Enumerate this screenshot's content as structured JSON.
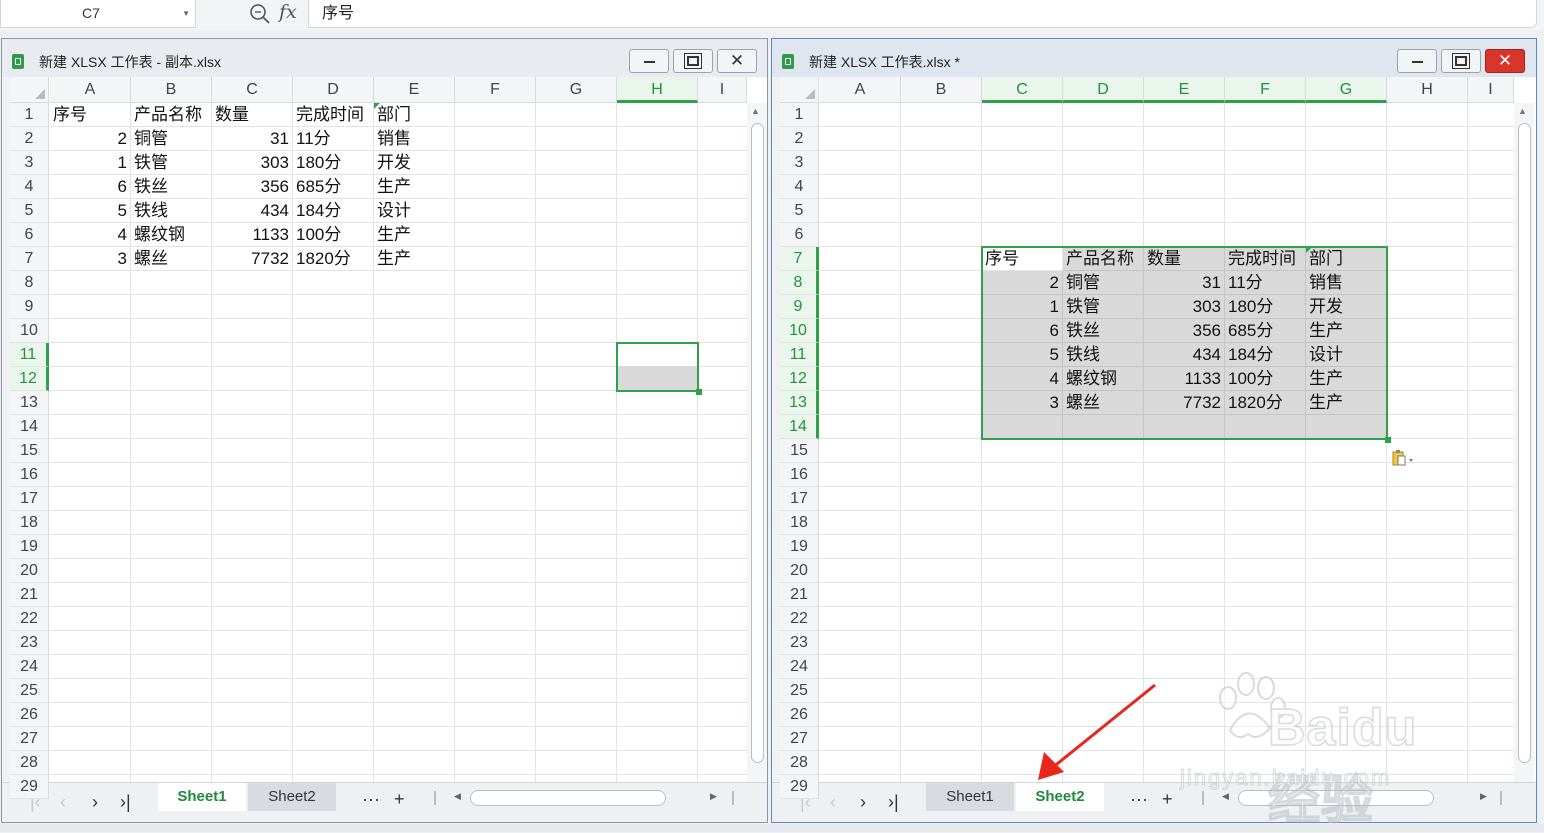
{
  "formula_bar": {
    "name_box": "C7",
    "fx_label": "fx",
    "formula": "序号"
  },
  "columns_all": [
    "A",
    "B",
    "C",
    "D",
    "E",
    "F",
    "G",
    "H",
    "I"
  ],
  "left_window": {
    "title": "新建 XLSX 工作表 - 副本.xlsx",
    "selected_column": "H",
    "selected_rows": [
      11,
      12
    ],
    "rows": [
      "1",
      "2",
      "3",
      "4",
      "5",
      "6",
      "7",
      "8",
      "9",
      "10",
      "11",
      "12",
      "13",
      "14",
      "15",
      "16",
      "17",
      "18",
      "19",
      "20",
      "21",
      "22",
      "23",
      "24",
      "25",
      "26",
      "27",
      "28",
      "29"
    ],
    "tabs": [
      "Sheet1",
      "Sheet2"
    ],
    "active_tab": "Sheet1"
  },
  "right_window": {
    "title": "新建 XLSX 工作表.xlsx *",
    "selected_columns": [
      "C",
      "D",
      "E",
      "F",
      "G"
    ],
    "selected_rows": [
      7,
      8,
      9,
      10,
      11,
      12,
      13,
      14
    ],
    "rows": [
      "1",
      "2",
      "3",
      "4",
      "5",
      "6",
      "7",
      "8",
      "9",
      "10",
      "11",
      "12",
      "13",
      "14",
      "15",
      "16",
      "17",
      "18",
      "19",
      "20",
      "21",
      "22",
      "23",
      "24",
      "25",
      "26",
      "27",
      "28",
      "29"
    ],
    "tabs": [
      "Sheet1",
      "Sheet2"
    ],
    "active_tab": "Sheet2"
  },
  "table": {
    "headers": [
      "序号",
      "产品名称",
      "数量",
      "完成时间",
      "部门"
    ],
    "rows": [
      [
        "2",
        "铜管",
        "31",
        "11分",
        "销售"
      ],
      [
        "1",
        "铁管",
        "303",
        "180分",
        "开发"
      ],
      [
        "6",
        "铁丝",
        "356",
        "685分",
        "生产"
      ],
      [
        "5",
        "铁线",
        "434",
        "184分",
        "设计"
      ],
      [
        "4",
        "螺纹钢",
        "1133",
        "100分",
        "生产"
      ],
      [
        "3",
        "螺丝",
        "7732",
        "1820分",
        "生产"
      ]
    ]
  },
  "tab_bar": {
    "more": "···",
    "add": "+"
  },
  "watermark": {
    "brand": "Baidu经验",
    "url": "jingyan.baidu.com"
  },
  "colors": {
    "accent_green": "#2fa148",
    "selection_shade": "#d9d9d9",
    "arrow_red": "#e8261c"
  }
}
